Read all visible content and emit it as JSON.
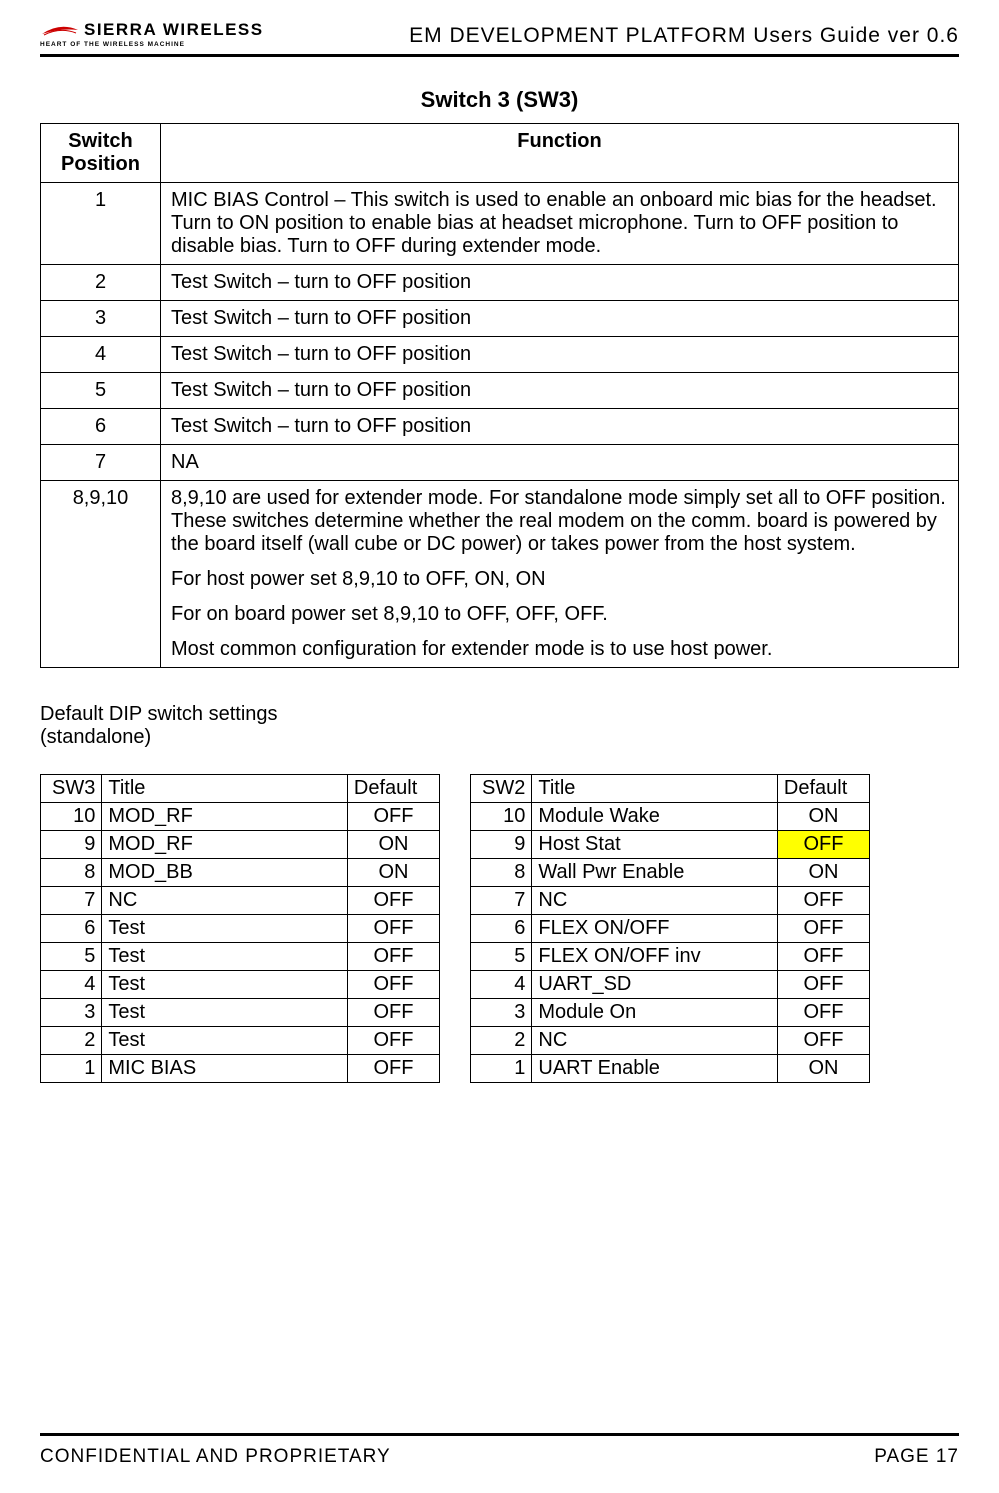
{
  "logo": {
    "name": "SIERRA WIRELESS",
    "tagline": "HEART OF THE WIRELESS MACHINE"
  },
  "doc_title": "EM DEVELOPMENT PLATFORM Users Guide ver 0.6",
  "section_title": "Switch 3 (SW3)",
  "main_table": {
    "header_pos": "Switch Position",
    "header_func": "Function",
    "rows": [
      {
        "pos": "1",
        "paras": [
          "MIC BIAS Control – This switch is used to enable an onboard mic bias for the headset.  Turn to ON position to enable bias at headset microphone.  Turn to OFF position to disable bias.  Turn to OFF during extender mode."
        ]
      },
      {
        "pos": "2",
        "paras": [
          "Test Switch – turn to OFF position"
        ]
      },
      {
        "pos": "3",
        "paras": [
          "Test Switch – turn to OFF position"
        ]
      },
      {
        "pos": "4",
        "paras": [
          "Test Switch – turn to OFF position"
        ]
      },
      {
        "pos": "5",
        "paras": [
          "Test Switch – turn to OFF position"
        ]
      },
      {
        "pos": "6",
        "paras": [
          "Test Switch – turn to OFF position"
        ]
      },
      {
        "pos": "7",
        "paras": [
          "NA"
        ]
      },
      {
        "pos": "8,9,10",
        "paras": [
          "8,9,10 are used for extender mode.  For standalone mode simply set all to OFF position.  These switches determine whether the real modem on the comm. board is powered by the board itself (wall cube or DC power) or takes power from the host system.",
          "For host power set 8,9,10 to OFF, ON, ON",
          "For on board power set 8,9,10 to OFF, OFF, OFF.",
          "Most common configuration for extender mode is to use host power."
        ]
      }
    ]
  },
  "caption_line1": "Default DIP switch settings",
  "caption_line2": "(standalone)",
  "sw3": {
    "code": "SW3",
    "title_hdr": "Title",
    "def_hdr": "Default",
    "rows": [
      {
        "n": "10",
        "t": "MOD_RF",
        "d": "OFF"
      },
      {
        "n": "9",
        "t": "MOD_RF",
        "d": "ON"
      },
      {
        "n": "8",
        "t": "MOD_BB",
        "d": "ON"
      },
      {
        "n": "7",
        "t": "NC",
        "d": "OFF"
      },
      {
        "n": "6",
        "t": "Test",
        "d": "OFF"
      },
      {
        "n": "5",
        "t": "Test",
        "d": "OFF"
      },
      {
        "n": "4",
        "t": "Test",
        "d": "OFF"
      },
      {
        "n": "3",
        "t": "Test",
        "d": "OFF"
      },
      {
        "n": "2",
        "t": "Test",
        "d": "OFF"
      },
      {
        "n": "1",
        "t": "MIC BIAS",
        "d": "OFF"
      }
    ]
  },
  "sw2": {
    "code": "SW2",
    "title_hdr": "Title",
    "def_hdr": "Default",
    "rows": [
      {
        "n": "10",
        "t": "Module Wake",
        "d": "ON",
        "hl": false
      },
      {
        "n": "9",
        "t": "Host Stat",
        "d": "OFF",
        "hl": true
      },
      {
        "n": "8",
        "t": "Wall Pwr Enable",
        "d": "ON",
        "hl": false
      },
      {
        "n": "7",
        "t": "NC",
        "d": "OFF",
        "hl": false
      },
      {
        "n": "6",
        "t": "FLEX ON/OFF",
        "d": "OFF",
        "hl": false
      },
      {
        "n": "5",
        "t": "FLEX ON/OFF inv",
        "d": "OFF",
        "hl": false
      },
      {
        "n": "4",
        "t": "UART_SD",
        "d": "OFF",
        "hl": false
      },
      {
        "n": "3",
        "t": "Module On",
        "d": "OFF",
        "hl": false
      },
      {
        "n": "2",
        "t": "NC",
        "d": "OFF",
        "hl": false
      },
      {
        "n": "1",
        "t": "UART Enable",
        "d": "ON",
        "hl": false
      }
    ]
  },
  "footer": {
    "left": "CONFIDENTIAL AND PROPRIETARY",
    "right": "PAGE 17"
  }
}
